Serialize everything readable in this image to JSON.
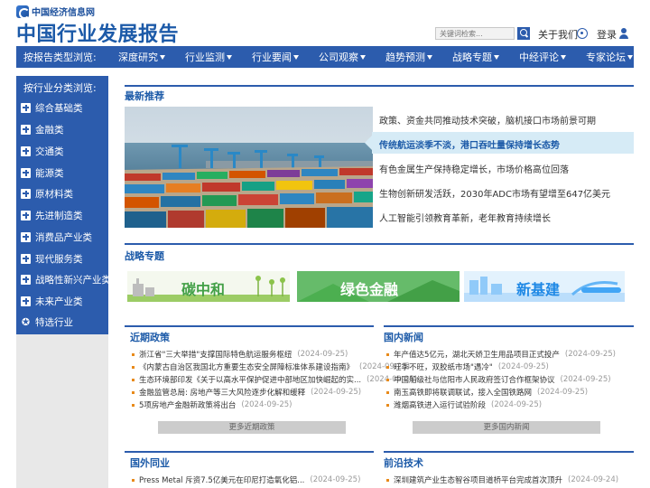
{
  "header": {
    "logo_text": "中国经济信息网",
    "site_title": "中国行业发展报告",
    "search_placeholder": "关键词检索...",
    "about_label": "关于我们",
    "login_label": "登录"
  },
  "nav": {
    "lead": "按报告类型浏览:",
    "items": [
      "深度研究",
      "行业监测",
      "行业要闻",
      "公司观察",
      "趋势预测",
      "战略专题",
      "中经评论",
      "专家论坛"
    ]
  },
  "sidebar": {
    "title": "按行业分类浏览:",
    "items": [
      "综合基础类",
      "金融类",
      "交通类",
      "能源类",
      "原材料类",
      "先进制造类",
      "消费品产业类",
      "现代服务类",
      "战略性新兴产业类",
      "未来产业类",
      "特选行业"
    ]
  },
  "featured": {
    "title": "最新推荐",
    "items": [
      "政策、资金共同推动技术突破，脑机接口市场前景可期",
      "传统航运淡季不淡，港口吞吐量保持增长态势",
      "有色金属生产保持稳定增长，市场价格高位回落",
      "生物创新研发活跃，2030年ADC市场有望增至647亿美元",
      "人工智能引领教育革新，老年教育持续增长"
    ]
  },
  "strategy": {
    "title": "战略专题",
    "banners": [
      "碳中和",
      "绿色金融",
      "新基建"
    ]
  },
  "recent_policy": {
    "title": "近期政策",
    "items": [
      {
        "text": "浙江省\"三大举措\"支撑国际特色航运服务枢纽",
        "date": "(2024-09-25)"
      },
      {
        "text": "《内蒙古自治区我国北方重要生态安全屏障标准体系建设指南》",
        "date": "(2024-09-25)"
      },
      {
        "text": "生态环境部印发《关于以高水平保护促进中部地区加快崛起的实...",
        "date": "(2024-09-25)"
      },
      {
        "text": "金融监管总局: 房地产等三大风险逐步化解和缓释",
        "date": "(2024-09-25)"
      },
      {
        "text": "5项房地产金融新政策将出台",
        "date": "(2024-09-25)"
      }
    ],
    "more": "更多近期政策"
  },
  "domestic_news": {
    "title": "国内新闻",
    "items": [
      {
        "text": "年产值达5亿元，湖北天娇卫生用品项目正式投产",
        "date": "(2024-09-25)"
      },
      {
        "text": "旺季不旺，双胶纸市场\"遇冷\"",
        "date": "(2024-09-25)"
      },
      {
        "text": "中国船级社与信阳市人民政府签订合作框架协议",
        "date": "(2024-09-25)"
      },
      {
        "text": "南玉高铁即将联调联试，接入全国铁路网",
        "date": "(2024-09-25)"
      },
      {
        "text": "潍烟高铁进入运行试验阶段",
        "date": "(2024-09-25)"
      }
    ],
    "more": "更多国内新闻"
  },
  "foreign": {
    "title": "国外同业",
    "items": [
      {
        "text": "Press Metal 斥资7.5亿美元在印尼打造氧化铝...",
        "date": "(2024-09-25)"
      }
    ]
  },
  "frontier": {
    "title": "前沿技术",
    "items": [
      {
        "text": "深圳建筑产业生态智谷项目道桥平台完成首次顶升",
        "date": "(2024-09-24)"
      }
    ]
  },
  "colors": {
    "brand_blue": "#2c5cad",
    "title_blue": "#1c5aa8",
    "bullet_orange": "#e88a1a",
    "highlight_bg": "#d6ebf6"
  }
}
